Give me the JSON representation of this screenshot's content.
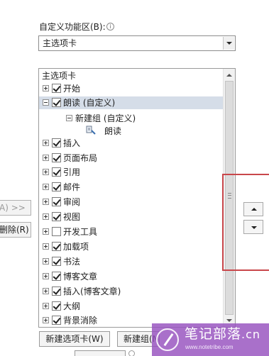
{
  "header": {
    "label": "自定义功能区(B):",
    "info_icon": "info-icon"
  },
  "combo": {
    "value": "主选项卡"
  },
  "tree": {
    "header": "主选项卡",
    "items": [
      {
        "label": "开始",
        "checked": true,
        "expander": "plus"
      },
      {
        "label": "朗读 (自定义)",
        "checked": true,
        "expander": "minus",
        "highlighted": true
      },
      {
        "label": "新建组 (自定义)",
        "expander": "minus"
      },
      {
        "label": "朗读",
        "icon": "speech-icon"
      },
      {
        "label": "插入",
        "checked": true,
        "expander": "plus"
      },
      {
        "label": "页面布局",
        "checked": true,
        "expander": "plus"
      },
      {
        "label": "引用",
        "checked": true,
        "expander": "plus"
      },
      {
        "label": "邮件",
        "checked": true,
        "expander": "plus"
      },
      {
        "label": "审阅",
        "checked": true,
        "expander": "plus"
      },
      {
        "label": "视图",
        "checked": true,
        "expander": "plus"
      },
      {
        "label": "开发工具",
        "checked": false,
        "expander": "plus"
      },
      {
        "label": "加载项",
        "checked": true,
        "expander": "plus"
      },
      {
        "label": "书法",
        "checked": true,
        "expander": "plus"
      },
      {
        "label": "博客文章",
        "checked": true,
        "expander": "plus"
      },
      {
        "label": "插入(博客文章)",
        "checked": true,
        "expander": "plus"
      },
      {
        "label": "大纲",
        "checked": true,
        "expander": "plus"
      },
      {
        "label": "背景消除",
        "checked": true,
        "expander": "plus"
      }
    ]
  },
  "side_buttons": {
    "add_label": "A) >>",
    "remove_label": "删除(R)"
  },
  "bottom_buttons": {
    "new_tab": "新建选项卡(W)",
    "new_group": "新建组(N"
  },
  "watermark": {
    "title": "笔记部落",
    "url": "www.notetribe.com",
    "suffix": ".cn"
  },
  "colors": {
    "highlight_box": "#c9474b",
    "selected_row": "#d5dde8",
    "watermark": "#9650be"
  }
}
